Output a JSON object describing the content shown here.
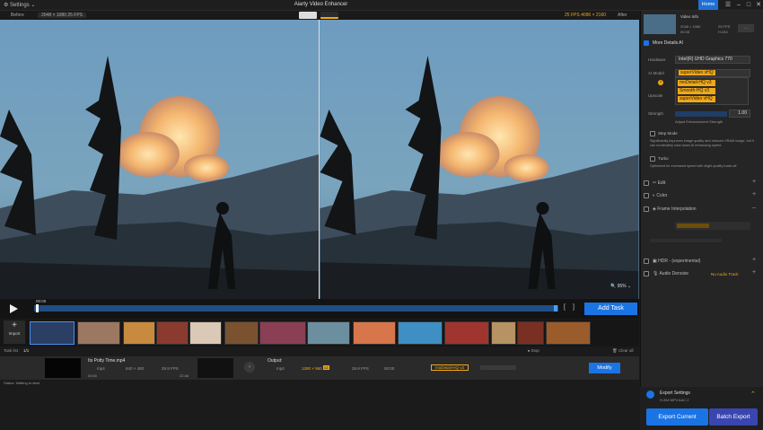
{
  "titlebar": {
    "settings": "Settings",
    "title": "Aiarty Video Enhancer",
    "home": "Home"
  },
  "preview": {
    "before_label": "Before",
    "before_info": "2048 × 1080  25 FPS",
    "after_label": "After",
    "after_info": "25 FPS  4096 × 2160",
    "zoom": "95%"
  },
  "timeline": {
    "time": "00:00",
    "add_task": "Add Task"
  },
  "import": {
    "label": "Import"
  },
  "tasklist": {
    "label": "Task list",
    "count": "1/1",
    "stop": "Stop",
    "clear": "Clear all"
  },
  "task": {
    "filename": "Its Potty Time.mp4",
    "in_format": "mp4",
    "in_res": "640 × 480",
    "in_fps": "29.9 FPS",
    "start": "00:00",
    "end": "22:48",
    "output_label": "Output:",
    "out_format": "mp4",
    "out_res": "1280 × 960",
    "out_badge": "x2",
    "out_fps": "29.9 FPS",
    "out_time": "00:00",
    "model": "moDetail-HQ v3",
    "modify": "Modify",
    "status": "Status: Waiting to start"
  },
  "panel": {
    "video_info": "Video Info",
    "vi_res": "2048 × 1080",
    "vi_fps": "25 FPS",
    "vi_dur": "00:08",
    "vi_codec": "H.264",
    "more_details": "More Details AI",
    "hardware_label": "Hardware",
    "hardware_value": "Intel(R) UHD Graphics 770",
    "ai_model_label": "AI Model",
    "ai_model_value": "superVideo vHQ",
    "models": [
      "moDetail-HQ v3",
      "Smooth-HQ v3",
      "superVideo vHQ"
    ],
    "upscale_label": "Upscale",
    "strength_label": "Strength",
    "strength_value": "1.00",
    "strength_hint": "Adjust Enhancement Strength",
    "step_mode": "Step Mode",
    "step_desc": "Significantly improves image quality and reduces VRAM usage, but it can moderately slow down AI enhancing speed.",
    "turbo": "Turbo",
    "turbo_desc": "Optimized for increased speed with slight quality trade-off",
    "edit": "Edit",
    "color": "Color",
    "frame_interp": "Frame Interpolation",
    "hdr": "HDR - (experimental)",
    "audio": "Audio Denoise",
    "no_audio": "No Audio Track",
    "export_settings": "Export Settings",
    "export_sub": "H.264 MP4  AAC 2",
    "export_current": "Export Current",
    "batch_export": "Batch Export"
  },
  "colors": {
    "accent": "#1b74e4",
    "orange": "#f0a81a",
    "batch": "#3a46b0"
  }
}
